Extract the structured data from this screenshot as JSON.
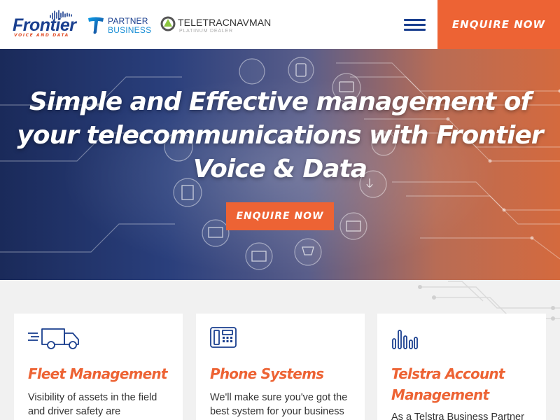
{
  "header": {
    "frontier_logo": {
      "name": "Frontier",
      "tagline": "VOICE AND DATA"
    },
    "telstra_logo": {
      "line1": "PARTNER",
      "line2": "BUSINESS"
    },
    "teletrac_logo": {
      "name": "TELETRACNAVMAN",
      "sub": "PLATINUM DEALER"
    },
    "menu_icon": "hamburger-icon",
    "enquire_label": "ENQUIRE NOW"
  },
  "hero": {
    "title": "Simple and Effective management of your telecommunications with Frontier Voice & Data",
    "enquire_label": "ENQUIRE NOW"
  },
  "services": [
    {
      "icon": "truck-icon",
      "title": "Fleet Management",
      "text": "Visibility of assets in the field and driver safety are"
    },
    {
      "icon": "phone-icon",
      "title": "Phone Systems",
      "text": "We'll make sure you've got the best system for your business"
    },
    {
      "icon": "bar-chart-icon",
      "title": "Telstra Account Management",
      "text": "As a Telstra Business Partner"
    }
  ],
  "colors": {
    "accent": "#ed6334",
    "brand": "#1a3f8f",
    "background": "#f1f1f1"
  }
}
